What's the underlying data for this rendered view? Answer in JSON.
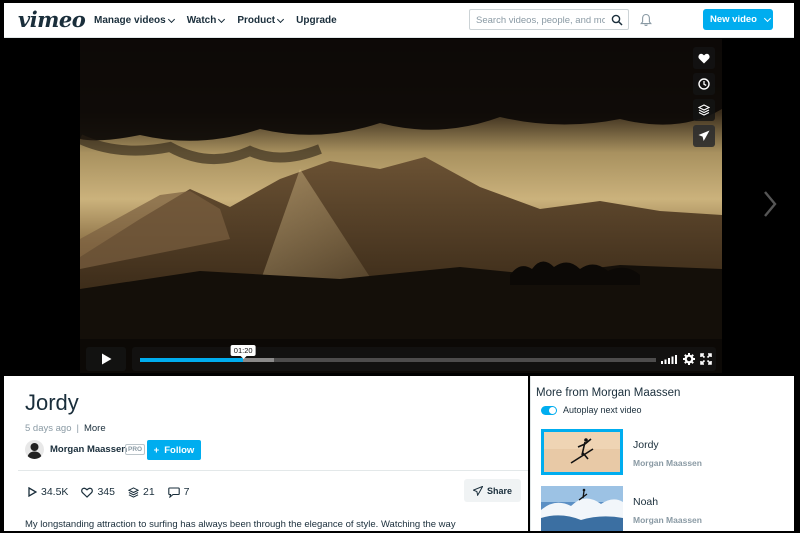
{
  "nav": {
    "logo": "vimeo",
    "menu": [
      "Manage videos",
      "Watch",
      "Product",
      "Upgrade"
    ],
    "search_placeholder": "Search videos, people, and more",
    "new_video": "New video"
  },
  "player": {
    "tooltip_time": "01:20",
    "progress_played": 0.2,
    "progress_loaded": 0.26
  },
  "video": {
    "title": "Jordy",
    "posted": "5 days ago",
    "separator": "|",
    "more": "More",
    "author": "Morgan Maassen",
    "badge": "PRO",
    "follow": "Follow",
    "stats": {
      "plays": "34.5K",
      "likes": "345",
      "collections": "21",
      "comments": "7"
    },
    "share": "Share",
    "description": "My longstanding attraction to surfing has always been through the elegance of style. Watching the way"
  },
  "sidebar": {
    "title": "More from Morgan Maassen",
    "autoplay_label": "Autoplay next video",
    "autoplay_on": true,
    "videos": [
      {
        "title": "Jordy",
        "author": "Morgan Maassen"
      },
      {
        "title": "Noah",
        "author": "Morgan Maassen"
      }
    ]
  },
  "colors": {
    "accent": "#00adef",
    "text": "#1a2e3b",
    "muted": "#8a9aa4"
  }
}
